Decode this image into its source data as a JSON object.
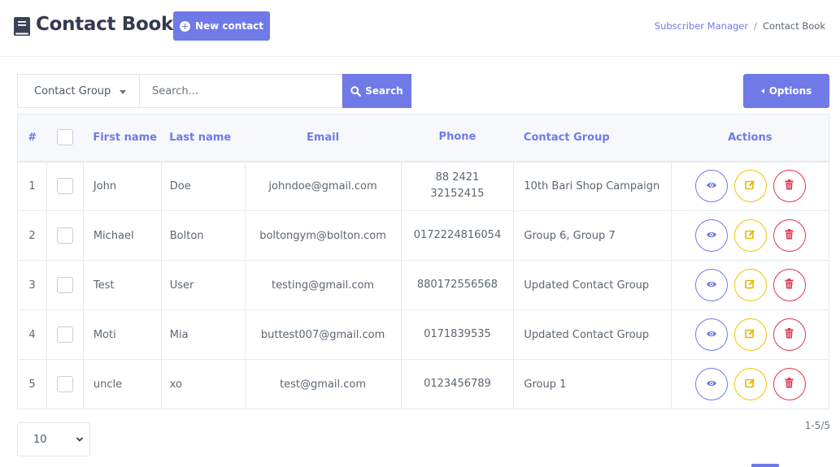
{
  "header": {
    "title": "Contact Book",
    "new_contact_label": "New contact",
    "breadcrumb": {
      "parent": "Subscriber Manager",
      "separator": "/",
      "current": "Contact Book"
    }
  },
  "toolbar": {
    "group_filter": "Contact Group",
    "search_placeholder": "Search...",
    "search_label": "Search",
    "options_label": "Options"
  },
  "table": {
    "columns": {
      "num": "#",
      "first_name": "First name",
      "last_name": "Last name",
      "email": "Email",
      "phone": "Phone",
      "contact_group": "Contact Group",
      "actions": "Actions"
    },
    "rows": [
      {
        "num": "1",
        "first_name": "John",
        "last_name": "Doe",
        "email": "johndoe@gmail.com",
        "phone": [
          "88 2421",
          "32152415"
        ],
        "group": "10th Bari Shop Campaign"
      },
      {
        "num": "2",
        "first_name": "Michael",
        "last_name": "Bolton",
        "email": "boltongym@bolton.com",
        "phone": [
          "0172224816054"
        ],
        "group": "Group 6, Group 7"
      },
      {
        "num": "3",
        "first_name": "Test",
        "last_name": "User",
        "email": "testing@gmail.com",
        "phone": [
          "880172556568"
        ],
        "group": "Updated Contact Group"
      },
      {
        "num": "4",
        "first_name": "Moti",
        "last_name": "Mia",
        "email": "buttest007@gmail.com",
        "phone": [
          "0171839535"
        ],
        "group": "Updated Contact Group"
      },
      {
        "num": "5",
        "first_name": "uncle",
        "last_name": "xo",
        "email": "test@gmail.com",
        "phone": [
          "0123456789"
        ],
        "group": "Group 1"
      }
    ]
  },
  "footer": {
    "per_page": "10",
    "range": "1-5/5"
  },
  "colors": {
    "primary": "#6f7ae7",
    "view": "#6f7ae7",
    "edit": "#f3c300",
    "delete": "#e0334c",
    "title": "#343a50"
  },
  "icons": {
    "title": "book-icon",
    "new": "plus-circle-icon",
    "search": "search-icon",
    "options": "caret-left-icon",
    "view": "eye-icon",
    "edit": "edit-icon",
    "delete": "trash-icon"
  }
}
